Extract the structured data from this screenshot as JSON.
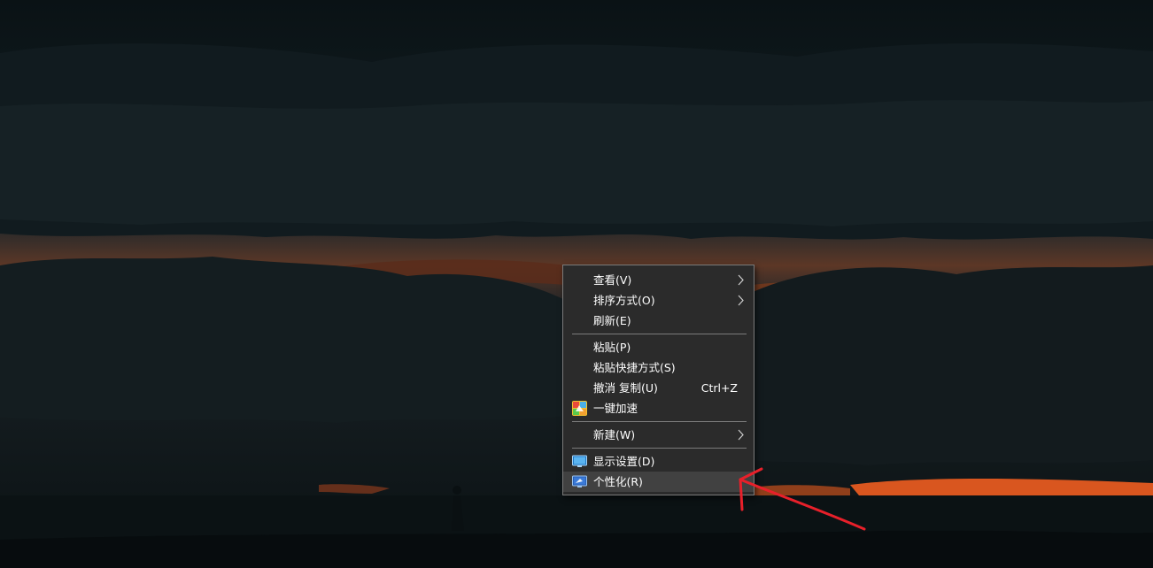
{
  "desktop": {
    "wallpaper": "dark-cloudy-sunset",
    "colors": {
      "sky_dark": "#0c1417",
      "cloud": "#1d2a2e",
      "sunset_orange": "#e0541c",
      "menu_bg": "#2b2b2b",
      "menu_border": "#7b7b7b",
      "menu_highlight": "#414141",
      "arrow_red": "#e8202a"
    }
  },
  "context_menu": {
    "items": [
      {
        "label": "查看(V)",
        "submenu": true
      },
      {
        "label": "排序方式(O)",
        "submenu": true
      },
      {
        "label": "刷新(E)"
      },
      {
        "label": "粘贴(P)"
      },
      {
        "label": "粘贴快捷方式(S)"
      },
      {
        "label": "撤消 复制(U)",
        "shortcut": "Ctrl+Z"
      },
      {
        "label": "一键加速",
        "icon": "speed-up-icon"
      },
      {
        "label": "新建(W)",
        "submenu": true
      },
      {
        "label": "显示设置(D)",
        "icon": "display-settings-icon"
      },
      {
        "label": "个性化(R)",
        "icon": "personalize-icon",
        "highlighted": true
      }
    ]
  },
  "annotation": {
    "type": "red-arrow",
    "points_to": "个性化(R)"
  }
}
